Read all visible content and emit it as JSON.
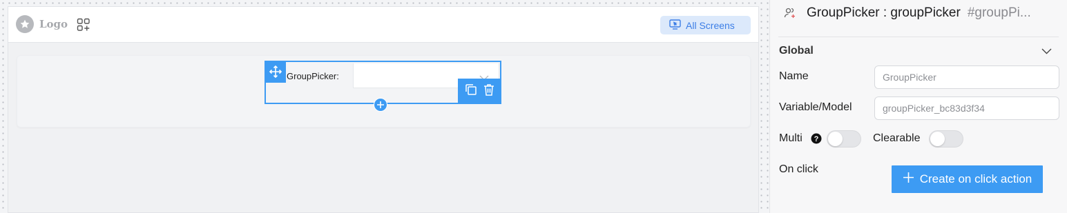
{
  "canvas": {
    "logo_text": "Logo",
    "all_screens_label": "All Screens",
    "component": {
      "label": "GroupPicker:",
      "select_value": ""
    }
  },
  "panel": {
    "component_name": "GroupPicker : groupPicker",
    "component_hash": "#groupPi...",
    "section_title": "Global",
    "name_label": "Name",
    "name_value": "GroupPicker",
    "variable_label": "Variable/Model",
    "variable_value": "groupPicker_bc83d3f34",
    "multi_label": "Multi",
    "multi_enabled": false,
    "clearable_label": "Clearable",
    "clearable_enabled": false,
    "on_click_label": "On click",
    "create_action_label": "Create on click action"
  },
  "colors": {
    "accent": "#3d9bf3",
    "all_screens_bg": "#dce9fb",
    "all_screens_text": "#3c7ee6"
  },
  "icons": [
    "star-icon",
    "apps-add-icon",
    "screen-cursor-icon",
    "move-icon",
    "chevron-down-icon",
    "copy-icon",
    "trash-icon",
    "plus-icon",
    "users-add-icon",
    "help-icon"
  ]
}
